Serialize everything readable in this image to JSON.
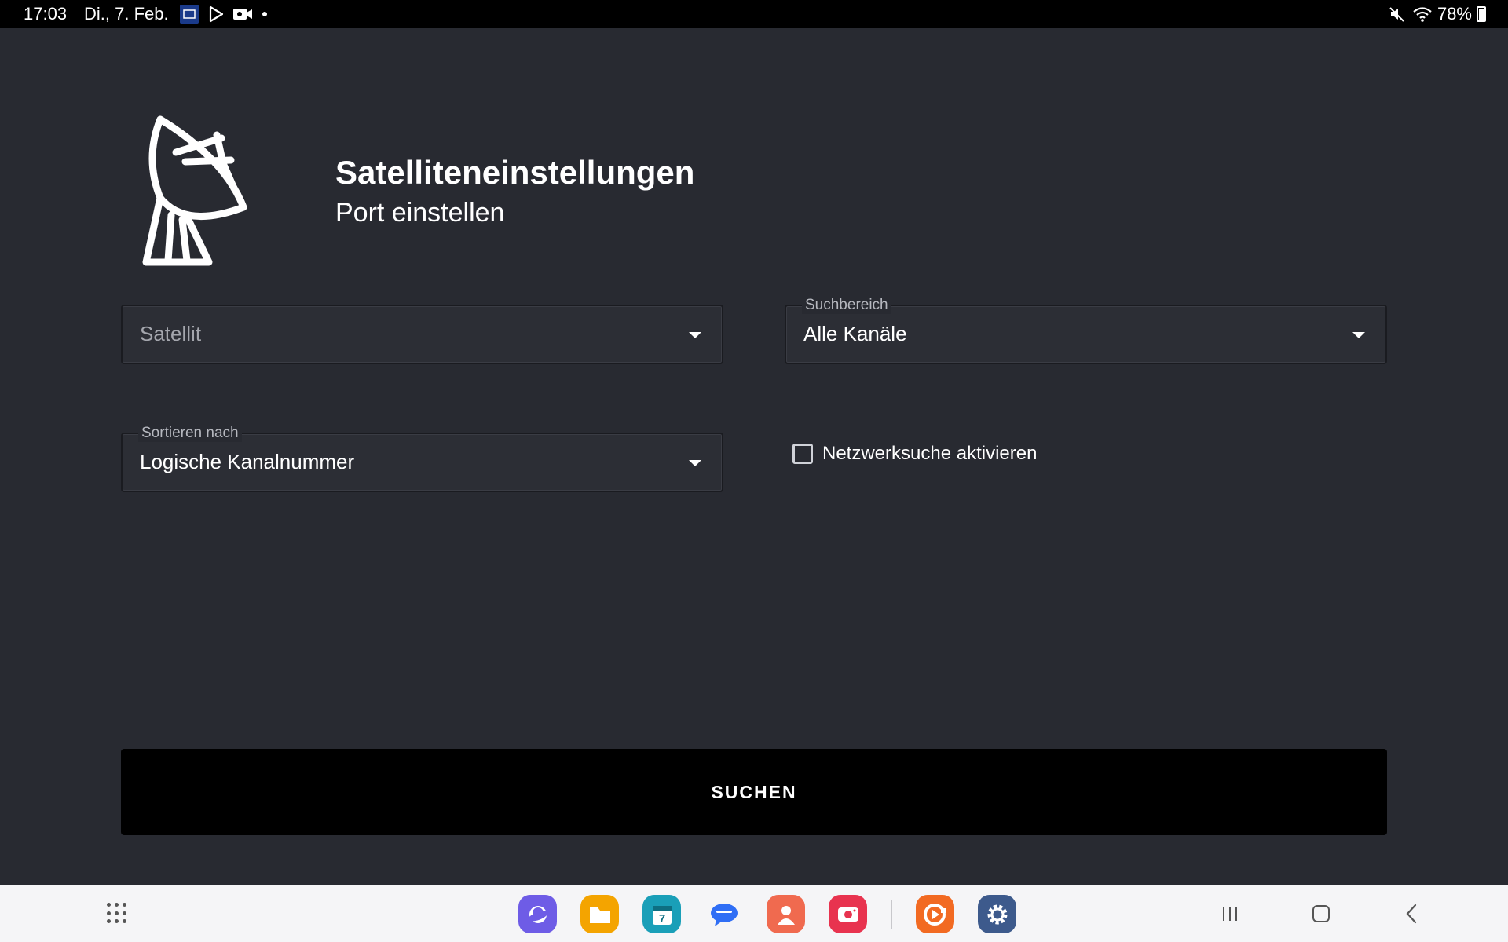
{
  "status_bar": {
    "time": "17:03",
    "date": "Di., 7. Feb.",
    "battery": "78%",
    "icons_left": [
      "tv-app-icon",
      "play-store-icon",
      "camera-icon",
      "notification-dot"
    ],
    "icons_right": [
      "mute-icon",
      "wifi-icon",
      "battery-icon"
    ]
  },
  "header": {
    "icon": "satellite-dish-icon",
    "title": "Satelliteneinstellungen",
    "subtitle": "Port einstellen"
  },
  "fields": {
    "satellit": {
      "placeholder": "Satellit"
    },
    "suchbereich": {
      "label": "Suchbereich",
      "value": "Alle Kanäle"
    },
    "sortieren": {
      "label": "Sortieren nach",
      "value": "Logische Kanalnummer"
    }
  },
  "checkbox": {
    "label": "Netzwerksuche aktivieren",
    "checked": false
  },
  "search_button": {
    "label": "SUCHEN"
  },
  "taskbar": {
    "apps": [
      {
        "name": "internet-app",
        "color": "#6e5ce6"
      },
      {
        "name": "files-app",
        "color": "#f4a400"
      },
      {
        "name": "calendar-app",
        "color": "#1a9fb8",
        "text": "7"
      },
      {
        "name": "messages-app",
        "color": "#2f6ef5"
      },
      {
        "name": "contacts-app",
        "color": "#f06a4f"
      },
      {
        "name": "screen-recorder-app",
        "color": "#e8334f"
      },
      {
        "name": "video-app",
        "color": "#f26a22"
      },
      {
        "name": "settings-app",
        "color": "#3d5a8c"
      }
    ],
    "colors": {
      "background": "#f5f5f7"
    }
  },
  "colors": {
    "background": "#282a31",
    "button": "#000000",
    "text": "#ffffff"
  }
}
